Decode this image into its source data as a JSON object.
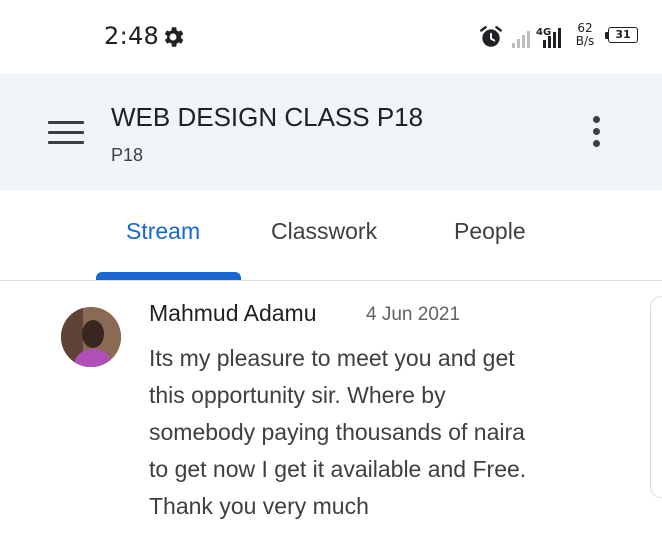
{
  "status_bar": {
    "time": "2:48",
    "network": "4G",
    "speed_value": "62",
    "speed_unit": "B/s",
    "battery": "31"
  },
  "app_bar": {
    "title": "WEB DESIGN CLASS P18",
    "subtitle": "P18"
  },
  "tabs": [
    {
      "label": "Stream",
      "active": true
    },
    {
      "label": "Classwork",
      "active": false
    },
    {
      "label": "People",
      "active": false
    }
  ],
  "comment": {
    "author": "Mahmud Adamu",
    "date": "4 Jun 2021",
    "lines": [
      "Its my pleasure to meet you and get",
      "this opportunity sir. Where by",
      "somebody paying thousands of naira",
      "to get now I get it available and Free.",
      "Thank you very much"
    ]
  },
  "colors": {
    "accent": "#1967d2",
    "app_bar_bg": "#f1f4f9"
  },
  "icons": [
    "gear-icon",
    "alarm-icon",
    "signal-icon",
    "battery-icon",
    "menu-icon",
    "more-vert-icon"
  ]
}
